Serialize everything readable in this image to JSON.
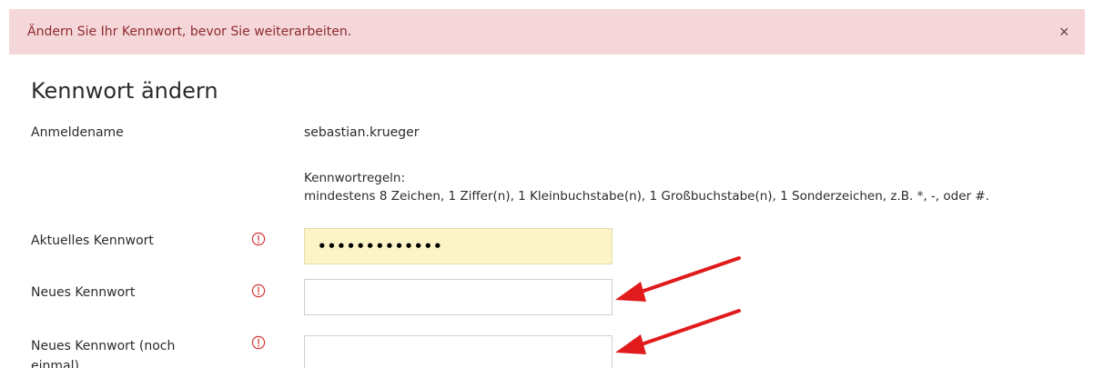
{
  "alert": {
    "message": "Ändern Sie Ihr Kennwort, bevor Sie weiterarbeiten.",
    "close_label": "×"
  },
  "page": {
    "title": "Kennwort ändern"
  },
  "form": {
    "login_label": "Anmeldename",
    "login_value": "sebastian.krueger",
    "rules_title": "Kennwortregeln:",
    "rules_text": "mindestens 8 Zeichen, 1 Ziffer(n), 1 Kleinbuchstabe(n), 1 Großbuchstabe(n), 1 Sonderzeichen, z.B. *, -, oder #.",
    "current_password_label": "Aktuelles Kennwort",
    "current_password_value": "•••••••••••••",
    "new_password_label": "Neues Kennwort",
    "new_password_value": "",
    "confirm_password_label_line1": "Neues Kennwort (noch",
    "confirm_password_label_line2": "einmal)",
    "confirm_password_value": ""
  },
  "colors": {
    "alert_bg": "#f6d7d9",
    "alert_text": "#8c2a31",
    "required_icon": "#d53a3a",
    "filled_input_bg": "#fcf3c7",
    "annotation_arrow": "#e11b1b"
  },
  "icons": {
    "required": "exclamation-circle-icon",
    "close": "close-icon",
    "annotation": "arrow-icon"
  }
}
